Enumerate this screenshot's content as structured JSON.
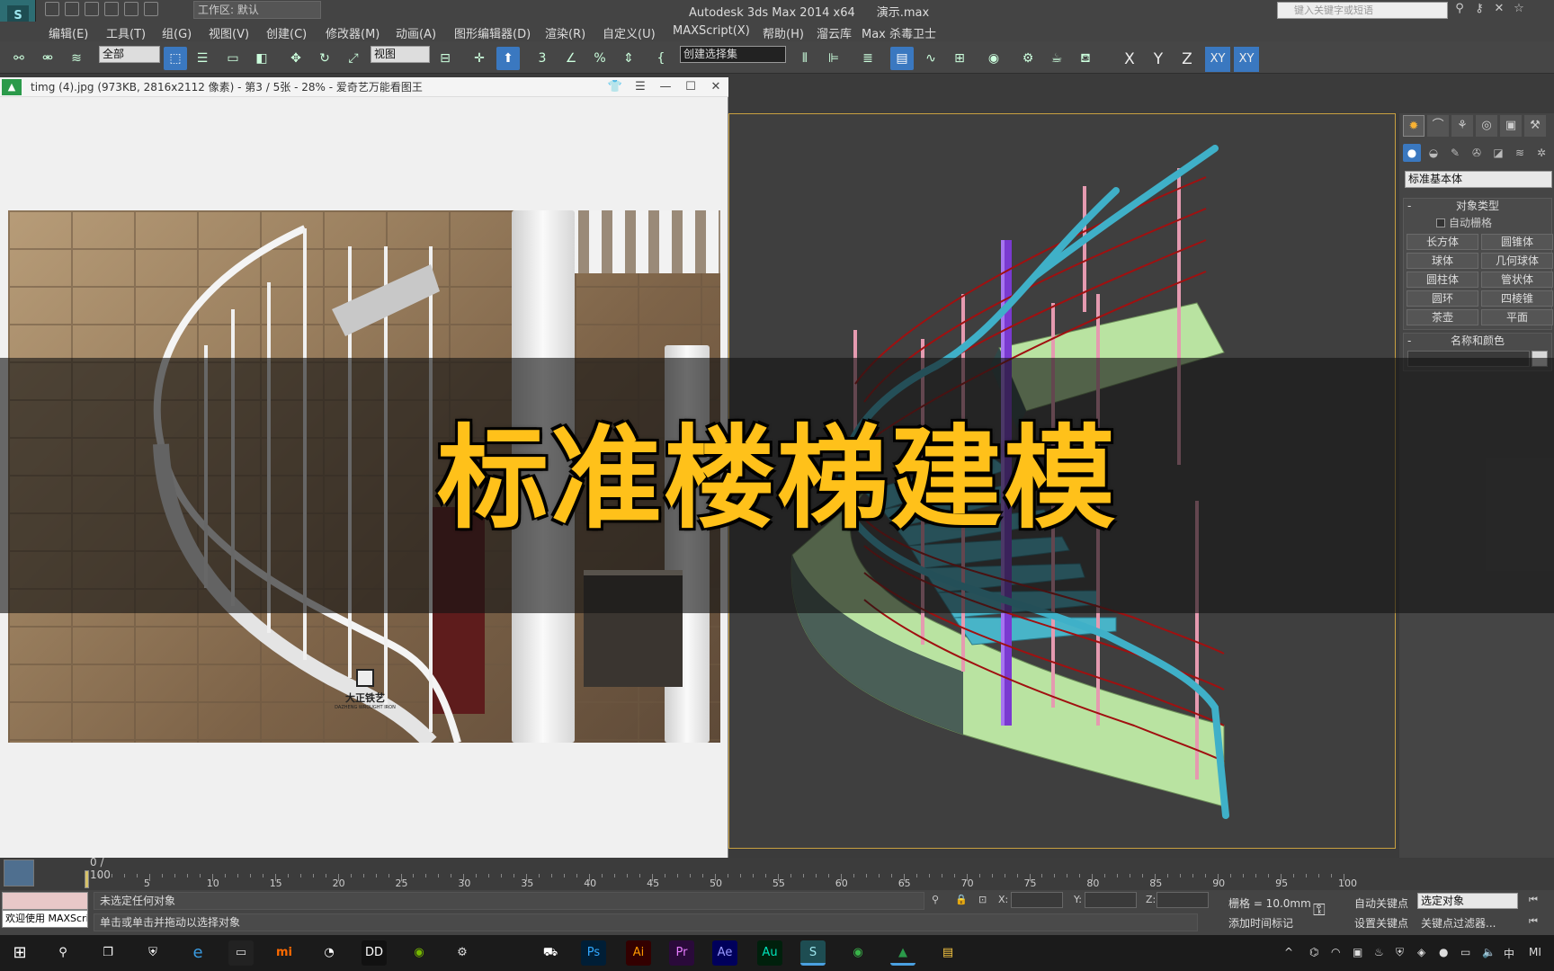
{
  "app": {
    "workspace": "工作区: 默认",
    "title": "Autodesk 3ds Max  2014 x64",
    "file": "演示.max",
    "search_placeholder": "键入关键字或短语"
  },
  "menu": [
    "编辑(E)",
    "工具(T)",
    "组(G)",
    "视图(V)",
    "创建(C)",
    "修改器(M)",
    "动画(A)",
    "图形编辑器(D)",
    "渲染(R)",
    "自定义(U)",
    "MAXScript(X)",
    "帮助(H)",
    "溜云库",
    "Max 杀毒卫士"
  ],
  "toolbar": {
    "filter": "全部",
    "ref_coord": "视图",
    "selection_set": "创建选择集",
    "axes": [
      "X",
      "Y",
      "Z",
      "XY",
      "XY"
    ]
  },
  "image_viewer": {
    "title": "timg (4).jpg (973KB, 2816x2112 像素) - 第3 / 5张 - 28% - 爱奇艺万能看图王",
    "watermark": "大正铁艺",
    "watermark_sub": "DAZHENG WROUGHT IRON"
  },
  "overlay_title": "标准楼梯建模",
  "command_panel": {
    "category": "标准基本体",
    "object_type_header": "对象类型",
    "auto_grid": "自动栅格",
    "buttons": [
      "长方体",
      "圆锥体",
      "球体",
      "几何球体",
      "圆柱体",
      "管状体",
      "圆环",
      "四棱锥",
      "茶壶",
      "平面"
    ],
    "name_color_header": "名称和颜色"
  },
  "timeline": {
    "range": "0 / 100",
    "ticks": [
      "5",
      "10",
      "15",
      "20",
      "25",
      "30",
      "35",
      "40",
      "45",
      "50",
      "55",
      "60",
      "65",
      "70",
      "75",
      "80",
      "85",
      "90",
      "95",
      "100"
    ]
  },
  "status": {
    "welcome": "欢迎使用 MAXScript",
    "prompt1": "未选定任何对象",
    "prompt2": "单击或单击并拖动以选择对象",
    "x_label": "X:",
    "y_label": "Y:",
    "z_label": "Z:",
    "grid": "栅格 = 10.0mm",
    "add_time_tag": "添加时间标记",
    "auto_key": "自动关键点",
    "set_key": "设置关键点",
    "selected": "选定对象",
    "key_filters": "关键点过滤器..."
  },
  "colors": {
    "accent": "#3a78c0",
    "title_yellow": "#ffc11a",
    "stair_green": "#b8e0a0",
    "rail_cyan": "#40b0c8",
    "baluster_pink": "#e090a8",
    "rail_red": "#a01010",
    "pole_purple": "#7a3ad0"
  }
}
